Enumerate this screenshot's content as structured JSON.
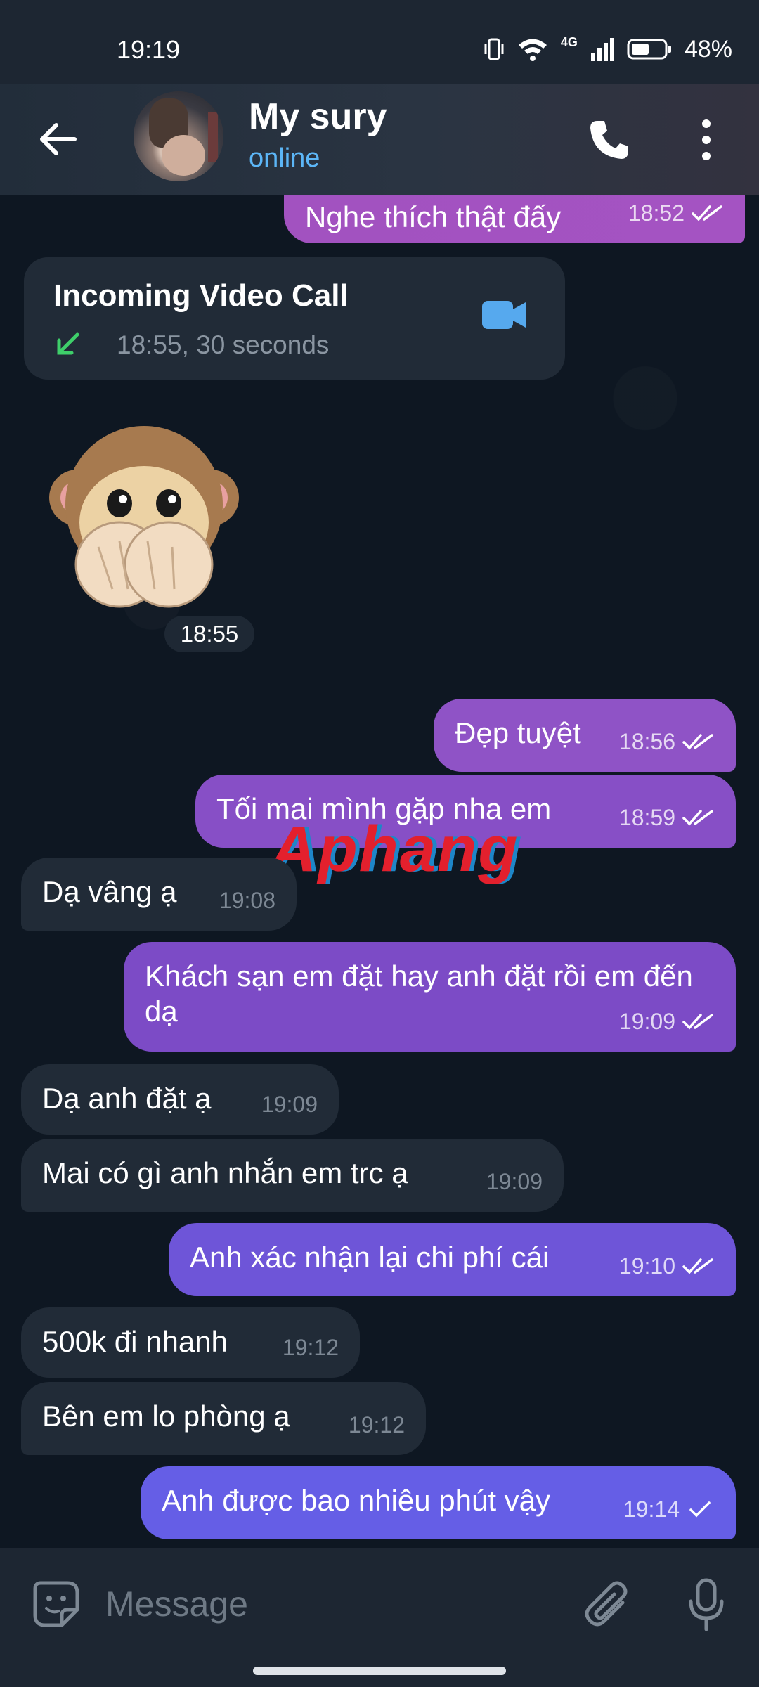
{
  "status_bar": {
    "time": "19:19",
    "network": "4G",
    "battery": "48%"
  },
  "header": {
    "name": "My sury",
    "status": "online",
    "accent": "#5cb6f7"
  },
  "call_card": {
    "title": "Incoming Video Call",
    "subtitle": "18:55, 30 seconds",
    "icon": "video-camera-icon"
  },
  "sticker": {
    "emoji": "see-no-evil-monkey",
    "time": "18:55"
  },
  "watermark": "Aphang",
  "messages": [
    {
      "text": "Nghe thích thật đấy",
      "time": "18:52",
      "dir": "out",
      "read": "double-check"
    },
    {
      "text": "Đẹp tuyệt",
      "time": "18:56",
      "dir": "out",
      "read": "double-check"
    },
    {
      "text": "Tối mai mình gặp nha em",
      "time": "18:59",
      "dir": "out",
      "read": "double-check"
    },
    {
      "text": "Dạ vâng ạ",
      "time": "19:08",
      "dir": "in"
    },
    {
      "text": "Khách sạn em đặt hay anh đặt rồi em đến dạ",
      "time": "19:09",
      "dir": "out",
      "read": "double-check"
    },
    {
      "text": "Dạ anh đặt ạ",
      "time": "19:09",
      "dir": "in"
    },
    {
      "text": "Mai có gì anh nhắn em trc ạ",
      "time": "19:09",
      "dir": "in"
    },
    {
      "text": "Anh xác nhận lại chi phí cái",
      "time": "19:10",
      "dir": "out",
      "read": "double-check"
    },
    {
      "text": "500k đi nhanh",
      "time": "19:12",
      "dir": "in"
    },
    {
      "text": "Bên em lo phòng ạ",
      "time": "19:12",
      "dir": "in"
    },
    {
      "text": "Anh được bao nhiêu phút vậy",
      "time": "19:14",
      "dir": "out",
      "read": "single-check"
    }
  ],
  "input": {
    "placeholder": "Message"
  },
  "colors": {
    "bubble_in": "#212b37",
    "bubble_out_top": "#a353c2",
    "bubble_out_bottom": "#6b63e6",
    "chat_bg": "#0e1722",
    "read_check": "#ffffff"
  }
}
